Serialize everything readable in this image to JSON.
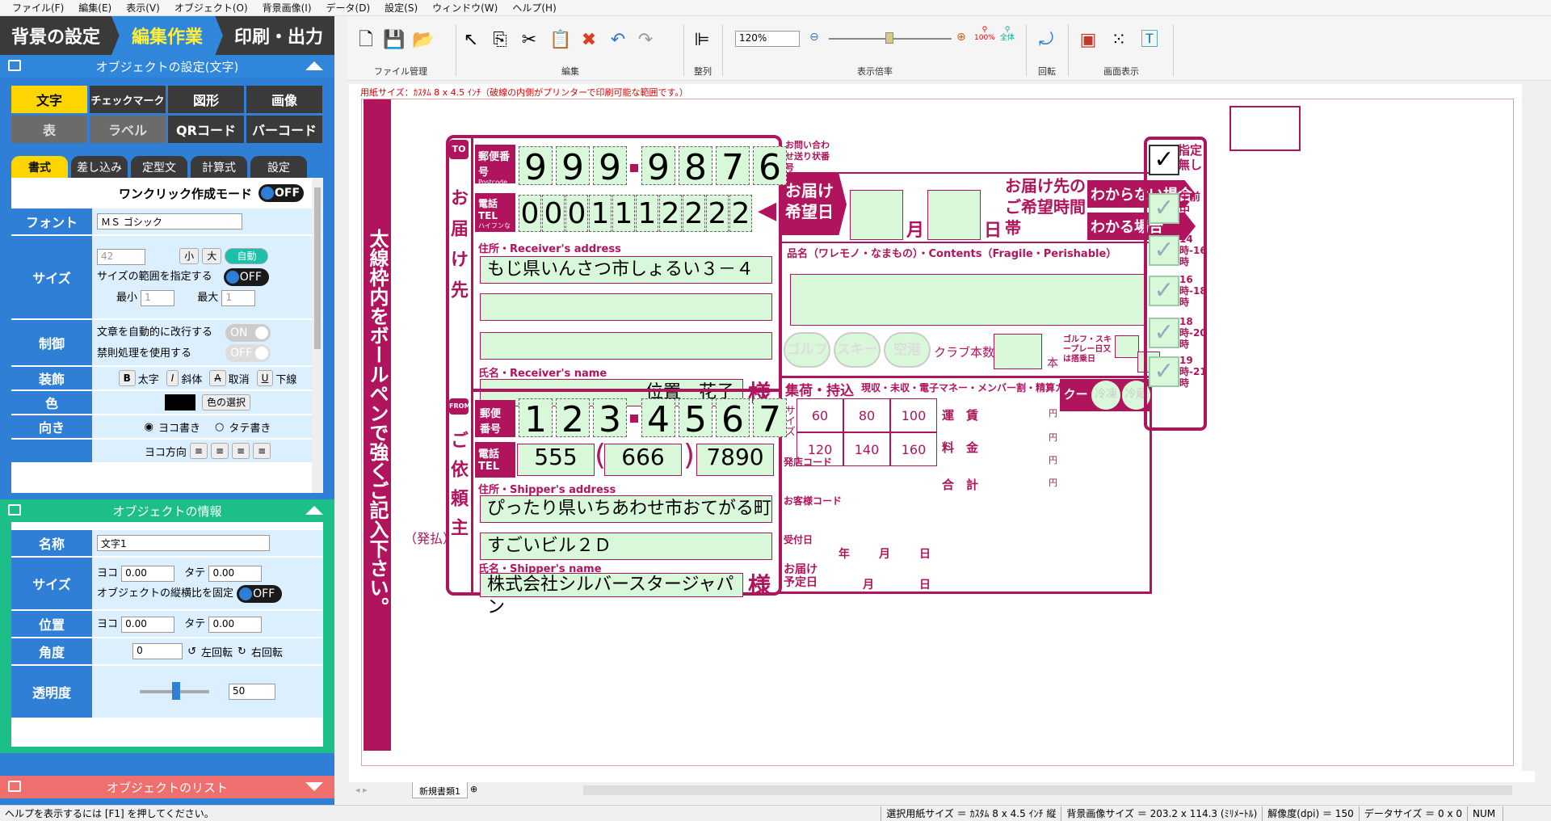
{
  "menu": [
    "ファイル(F)",
    "編集(E)",
    "表示(V)",
    "オブジェクト(O)",
    "背景画像(I)",
    "データ(D)",
    "設定(S)",
    "ウィンドウ(W)",
    "ヘルプ(H)"
  ],
  "steps": [
    "背景の設定",
    "編集作業",
    "印刷・出力"
  ],
  "obj_settings_title": "オブジェクトの設定(文字)",
  "obj_tabs": [
    "文字",
    "チェックマーク",
    "図形",
    "画像",
    "表",
    "ラベル",
    "QRコード",
    "バーコード"
  ],
  "sub_tabs": [
    "書式",
    "差し込み",
    "定型文",
    "計算式",
    "設定"
  ],
  "props": {
    "oneclick": "ワンクリック作成モード",
    "oneclick_state": "OFF",
    "font_label": "フォント",
    "font_value": "ＭＳ ゴシック",
    "size_label": "サイズ",
    "size_value": "42",
    "size_small": "小",
    "size_large": "大",
    "size_auto": "自動",
    "size_range": "サイズの範囲を指定する",
    "size_range_state": "OFF",
    "min_label": "最小",
    "min_value": "1",
    "max_label": "最大",
    "max_value": "1",
    "control_label": "制御",
    "wrap": "文章を自動的に改行する",
    "wrap_state": "ON",
    "kinsoku": "禁則処理を使用する",
    "kinsoku_state": "OFF",
    "deco_label": "装飾",
    "bold": "太字",
    "italic": "斜体",
    "strike": "取消",
    "underline": "下線",
    "color_label": "色",
    "color_btn": "色の選択",
    "dir_label": "向き",
    "dir_h": "ヨコ書き",
    "dir_v": "タテ書き",
    "yoko_dir": "ヨコ方向"
  },
  "info_title": "オブジェクトの情報",
  "info": {
    "name_label": "名称",
    "name_value": "文字1",
    "size_label": "サイズ",
    "yoko": "ヨコ",
    "tate": "タテ",
    "w": "0.00",
    "h": "0.00",
    "ratio": "オブジェクトの縦横比を固定",
    "ratio_state": "OFF",
    "pos_label": "位置",
    "x": "0.00",
    "y": "0.00",
    "angle_label": "角度",
    "angle": "0",
    "rot_left": "左回転",
    "rot_right": "右回転",
    "alpha_label": "透明度",
    "alpha": "50"
  },
  "list_title": "オブジェクトのリスト",
  "toolbar": {
    "file": "ファイル管理",
    "edit": "編集",
    "align": "整列",
    "zoom": "表示倍率",
    "zoom_value": "120%",
    "rotate": "回転",
    "view": "画面表示",
    "z100": "100%",
    "zall": "全体"
  },
  "paper_note": "用紙サイズ：ｶｽﾀﾑ 8 x 4.5 ｲﾝﾁ（破線の内側がプリンターで印刷可能な範囲です。）",
  "label": {
    "side_text": "太線枠内をボールペンで強くご記入下さい。",
    "hatsubarai": "（発払）",
    "to": "TO",
    "to_v": "お届け先",
    "from": "FROM",
    "from_v": "ご依頼主",
    "yubin": "郵便番号",
    "postcode": "Postcode",
    "to_zip": [
      "9",
      "9",
      "9",
      "9",
      "8",
      "7",
      "6"
    ],
    "tel": "電話TEL",
    "hyphen": "ハイフンなし",
    "to_tel": [
      "0",
      "0",
      "0",
      "1",
      "1",
      "1",
      "2",
      "2",
      "2",
      "2"
    ],
    "addr_label": "住所・Receiver's address",
    "to_addr": "もじ県いんさつ市しょるい３－４",
    "name_label": "氏名・Receiver's name",
    "to_name": "位置　花子",
    "sama": "様",
    "from_zip": [
      "1",
      "2",
      "3",
      "4",
      "5",
      "6",
      "7"
    ],
    "from_tel": [
      "555",
      "666",
      "7890"
    ],
    "saddr_label": "住所・Shipper's address",
    "from_addr1": "ぴったり県いちあわせ市おてがる町",
    "from_addr2": "すごいビル２Ｄ",
    "sname_label": "氏名・Shipper's name",
    "from_name": "株式会社シルバースタージャパン",
    "inquiry": "お問い合わせ送り状番号",
    "wish_date": "お届け希望日",
    "month": "月",
    "day": "日",
    "time_zone": "お届け先のご希望時間帯",
    "unknown": "わからない場合",
    "known": "わかる場合",
    "contents": "品名（ワレモノ・なまもの）・Contents（Fragile・Perishable）",
    "golf": "ゴルフ",
    "ski": "スキー",
    "airport": "空港",
    "club": "クラブ本数",
    "hon": "本",
    "golf_ski": "ゴルフ・スキープレー日又は搭乗日",
    "shuka": "集荷・持込",
    "payment": "現収・未収・電子マネー・メンバー割・精算カード・回数券",
    "size": "サイズ",
    "sizes": [
      "60",
      "80",
      "100",
      "120",
      "140",
      "160"
    ],
    "unchin": "運　賃",
    "ryokin": "料　金",
    "gokei": "合　計",
    "yen": "円",
    "cool": "クール",
    "reito": "冷凍",
    "reizo": "冷蔵",
    "hassho": "発店コード",
    "okyaku": "お客様コード",
    "uketsuke": "受付日",
    "nen": "年",
    "tsuki": "月",
    "hi": "日",
    "yotei": "お届け予定日",
    "shitei": "指定無し",
    "gozen": "午前中",
    "t1": "14時-16時",
    "t2": "16時-18時",
    "t3": "18時-20時",
    "t4": "19時-21時"
  },
  "tab_name": "新規書類1",
  "status": {
    "help": "ヘルプを表示するには [F1] を押してください。",
    "paper": "選択用紙サイズ ＝ ｶｽﾀﾑ 8 x 4.5 ｲﾝﾁ 縦",
    "bg": "背景画像サイズ ＝ 203.2 x 114.3 (ﾐﾘﾒｰﾄﾙ)",
    "dpi": "解像度(dpi) ＝ 150",
    "data": "データサイズ ＝ 0 x 0",
    "num": "NUM"
  }
}
